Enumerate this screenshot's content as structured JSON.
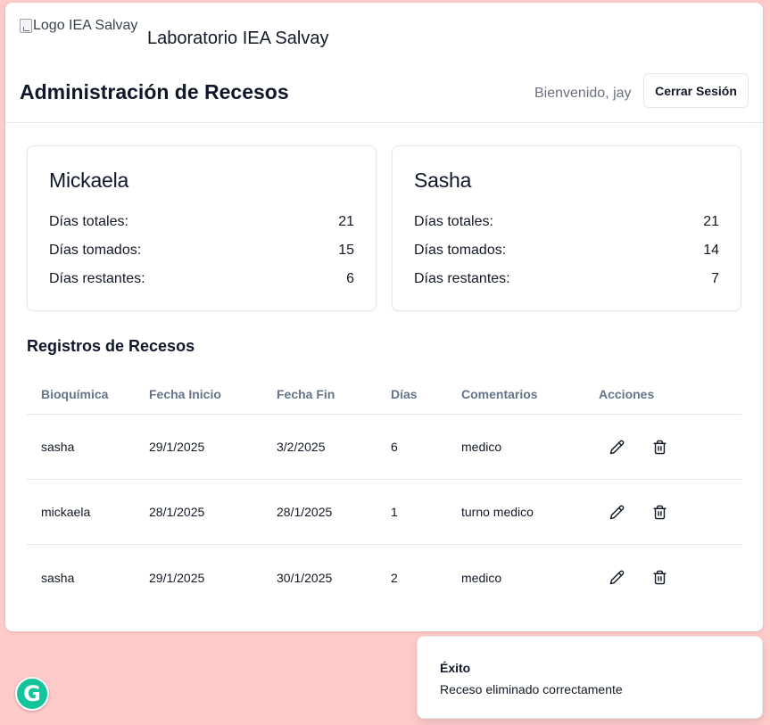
{
  "header": {
    "logo_alt": "Logo IEA Salvay",
    "lab_name": "Laboratorio IEA Salvay",
    "page_title": "Administración de Recesos",
    "welcome": "Bienvenido, jay",
    "logout_label": "Cerrar Sesión"
  },
  "summary": [
    {
      "name": "Mickaela",
      "total_label": "Días totales:",
      "total": "21",
      "taken_label": "Días tomados:",
      "taken": "15",
      "remaining_label": "Días restantes:",
      "remaining": "6"
    },
    {
      "name": "Sasha",
      "total_label": "Días totales:",
      "total": "21",
      "taken_label": "Días tomados:",
      "taken": "14",
      "remaining_label": "Días restantes:",
      "remaining": "7"
    }
  ],
  "records": {
    "title": "Registros de Recesos",
    "columns": [
      "Bioquímica",
      "Fecha Inicio",
      "Fecha Fin",
      "Días",
      "Comentarios",
      "Acciones"
    ],
    "rows": [
      {
        "bioquimica": "sasha",
        "inicio": "29/1/2025",
        "fin": "3/2/2025",
        "dias": "6",
        "comentarios": "medico"
      },
      {
        "bioquimica": "mickaela",
        "inicio": "28/1/2025",
        "fin": "28/1/2025",
        "dias": "1",
        "comentarios": "turno medico"
      },
      {
        "bioquimica": "sasha",
        "inicio": "29/1/2025",
        "fin": "30/1/2025",
        "dias": "2",
        "comentarios": "medico"
      }
    ],
    "actions": {
      "edit_icon": "pencil-icon",
      "delete_icon": "trash-icon"
    }
  },
  "toast": {
    "title": "Éxito",
    "message": "Receso eliminado correctamente"
  },
  "extension": {
    "icon": "grammarly-icon",
    "glyph": "G"
  },
  "colors": {
    "page_background": "#fecaca",
    "card_background": "#ffffff",
    "muted_text": "#64748b",
    "grammarly_green": "#15c39a"
  }
}
